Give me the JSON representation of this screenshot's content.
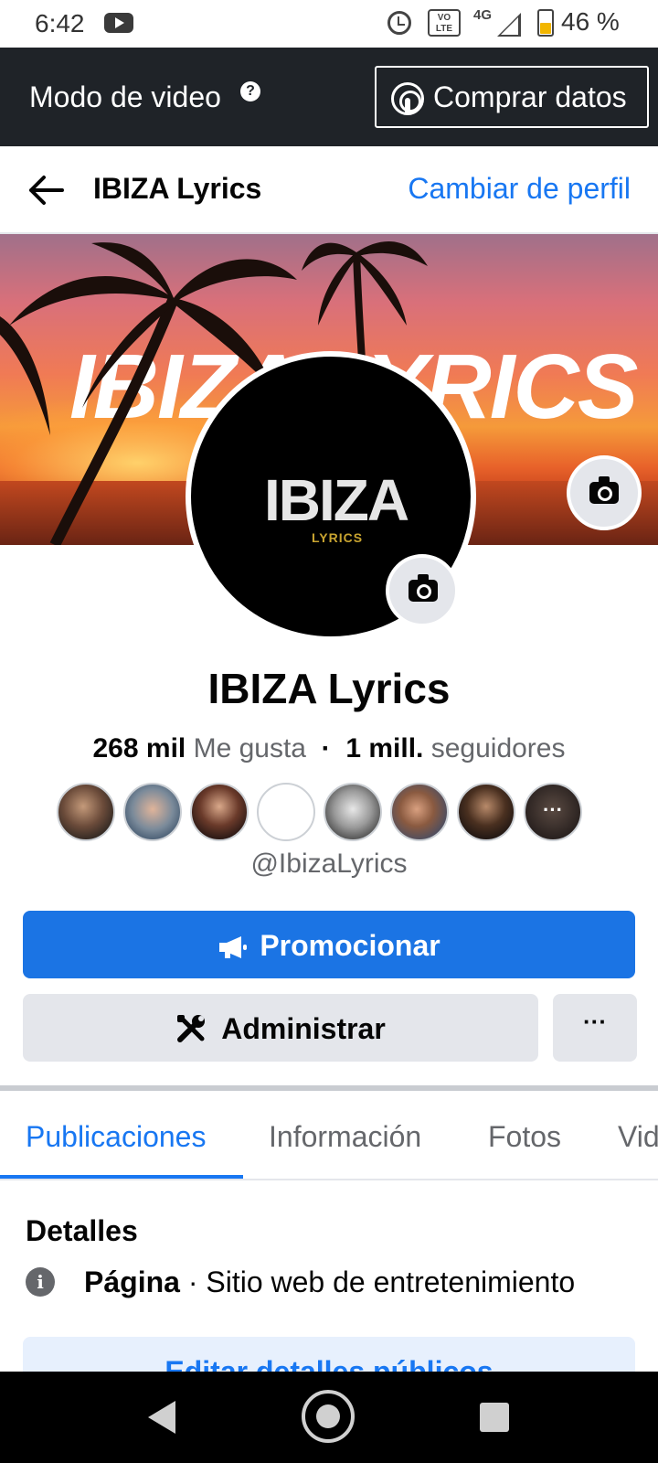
{
  "status_bar": {
    "time": "6:42",
    "network": "4G",
    "volte": "VO\nLTE",
    "battery_percent_label": "46 %",
    "battery_level": 0.46,
    "icons": [
      "youtube-icon",
      "alarm-icon",
      "volte-icon",
      "network-4g-icon",
      "signal-icon",
      "battery-icon"
    ]
  },
  "video_bar": {
    "label": "Modo de video",
    "help_icon": "?",
    "buy_data_label": "Comprar datos"
  },
  "header": {
    "title": "IBIZA Lyrics",
    "switch_profile_label": "Cambiar de perfil"
  },
  "cover": {
    "text": "IBIZA LYRICS"
  },
  "profile": {
    "logo_text": "IBIZA",
    "logo_sub": "LYRICS",
    "name": "IBIZA Lyrics",
    "likes_count": "268 mil",
    "likes_label": "Me gusta",
    "separator": "·",
    "followers_count": "1 mill.",
    "followers_label": "seguidores",
    "handle": "@IbizaLyrics",
    "more_avatars_label": "···"
  },
  "actions": {
    "promote_label": "Promocionar",
    "manage_label": "Administrar",
    "more_label": "···"
  },
  "tabs": [
    {
      "label": "Publicaciones",
      "active": true
    },
    {
      "label": "Información",
      "active": false
    },
    {
      "label": "Fotos",
      "active": false
    },
    {
      "label": "Vid",
      "active": false
    }
  ],
  "details": {
    "heading": "Detalles",
    "info_icon": "i",
    "type_label": "Página",
    "type_separator": " · ",
    "category": "Sitio web de entretenimiento",
    "edit_button_label": "Editar detalles públicos"
  },
  "colors": {
    "accent": "#1877f2",
    "primary_button": "#1b74e4",
    "secondary_button": "#e4e6eb",
    "dark_bar": "#1f2328"
  }
}
